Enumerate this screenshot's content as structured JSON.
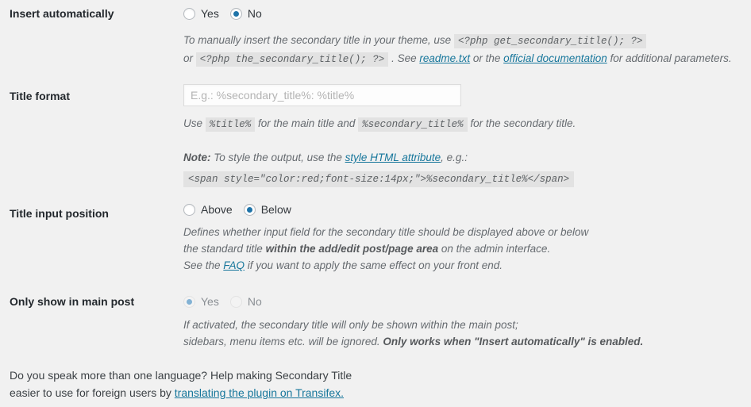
{
  "page": {
    "background_color": "#f1f1f1",
    "link_color": "#16769b",
    "accent_color": "#1e73a8"
  },
  "settings": [
    {
      "key": "insert_automatically",
      "label": "Insert automatically",
      "control": "radio",
      "options": [
        {
          "label": "Yes",
          "checked": false
        },
        {
          "label": "No",
          "checked": true
        }
      ],
      "description_lines": [
        {
          "parts": [
            {
              "type": "text",
              "text": "To manually insert the secondary title in your theme, use "
            },
            {
              "type": "code",
              "text": "<?php get_secondary_title(); ?>"
            }
          ]
        },
        {
          "parts": [
            {
              "type": "text",
              "text": "or "
            },
            {
              "type": "code",
              "text": "<?php the_secondary_title(); ?>"
            },
            {
              "type": "text",
              "text": " . See "
            },
            {
              "type": "link",
              "text": "readme.txt"
            },
            {
              "type": "text",
              "text": " or the "
            },
            {
              "type": "link",
              "text": "official documentation"
            },
            {
              "type": "text",
              "text": " for additional parameters."
            }
          ]
        }
      ]
    },
    {
      "key": "title_format",
      "label": "Title format",
      "control": "text",
      "value": "",
      "placeholder": "E.g.: %secondary_title%: %title%",
      "description_lines": [
        {
          "parts": [
            {
              "type": "text",
              "text": "Use "
            },
            {
              "type": "code",
              "text": "%title%"
            },
            {
              "type": "text",
              "text": " for the main title and "
            },
            {
              "type": "code",
              "text": "%secondary_title%"
            },
            {
              "type": "text",
              "text": " for the secondary title."
            }
          ]
        },
        {
          "parts": [
            {
              "type": "bold",
              "text": "Note:"
            },
            {
              "type": "text",
              "text": " To style the output, use the "
            },
            {
              "type": "link",
              "text": "style HTML attribute"
            },
            {
              "type": "text",
              "text": ", e.g.:"
            }
          ]
        },
        {
          "parts": [
            {
              "type": "code-block",
              "text": "<span style=\"color:red;font-size:14px;\">%secondary_title%</span>"
            }
          ]
        }
      ]
    },
    {
      "key": "title_input_position",
      "label": "Title input position",
      "control": "radio",
      "options": [
        {
          "label": "Above",
          "checked": false
        },
        {
          "label": "Below",
          "checked": true
        }
      ],
      "description_lines": [
        {
          "parts": [
            {
              "type": "text",
              "text": "Defines whether input field for the secondary title should be displayed above or below"
            }
          ]
        },
        {
          "parts": [
            {
              "type": "text",
              "text": "the standard title "
            },
            {
              "type": "bold",
              "text": "within the add/edit post/page area"
            },
            {
              "type": "text",
              "text": " on the admin interface."
            }
          ]
        },
        {
          "parts": [
            {
              "type": "text",
              "text": "See the "
            },
            {
              "type": "link",
              "text": "FAQ"
            },
            {
              "type": "text",
              "text": " if you want to apply the same effect on your front end."
            }
          ]
        }
      ]
    },
    {
      "key": "only_show_in_main_post",
      "label": "Only show in main post",
      "control": "radio",
      "disabled": true,
      "options": [
        {
          "label": "Yes",
          "checked": true
        },
        {
          "label": "No",
          "checked": false
        }
      ],
      "description_lines": [
        {
          "parts": [
            {
              "type": "text",
              "text": "If activated, the secondary title will only be shown within the main post;"
            }
          ]
        },
        {
          "parts": [
            {
              "type": "text",
              "text": "sidebars, menu items etc. will be ignored. "
            },
            {
              "type": "bold",
              "text": "Only works when \"Insert automatically\" is enabled."
            }
          ]
        }
      ]
    }
  ],
  "footer": {
    "line1": "Do you speak more than one language? Help making Secondary Title",
    "line2_prefix": "easier to use for foreign users by ",
    "link_text": "translating the plugin on Transifex."
  }
}
